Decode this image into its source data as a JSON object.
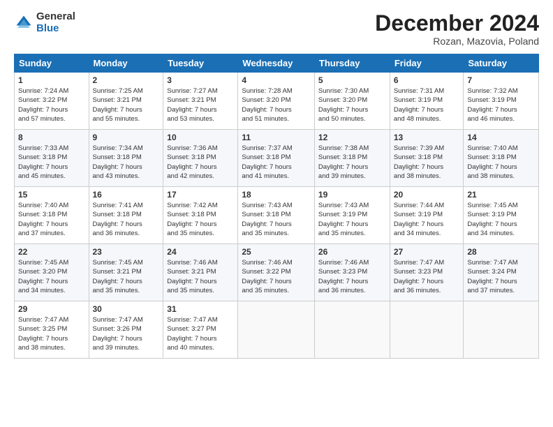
{
  "logo": {
    "general": "General",
    "blue": "Blue"
  },
  "header": {
    "month": "December 2024",
    "location": "Rozan, Mazovia, Poland"
  },
  "weekdays": [
    "Sunday",
    "Monday",
    "Tuesday",
    "Wednesday",
    "Thursday",
    "Friday",
    "Saturday"
  ],
  "weeks": [
    [
      {
        "day": "1",
        "info": "Sunrise: 7:24 AM\nSunset: 3:22 PM\nDaylight: 7 hours\nand 57 minutes."
      },
      {
        "day": "2",
        "info": "Sunrise: 7:25 AM\nSunset: 3:21 PM\nDaylight: 7 hours\nand 55 minutes."
      },
      {
        "day": "3",
        "info": "Sunrise: 7:27 AM\nSunset: 3:21 PM\nDaylight: 7 hours\nand 53 minutes."
      },
      {
        "day": "4",
        "info": "Sunrise: 7:28 AM\nSunset: 3:20 PM\nDaylight: 7 hours\nand 51 minutes."
      },
      {
        "day": "5",
        "info": "Sunrise: 7:30 AM\nSunset: 3:20 PM\nDaylight: 7 hours\nand 50 minutes."
      },
      {
        "day": "6",
        "info": "Sunrise: 7:31 AM\nSunset: 3:19 PM\nDaylight: 7 hours\nand 48 minutes."
      },
      {
        "day": "7",
        "info": "Sunrise: 7:32 AM\nSunset: 3:19 PM\nDaylight: 7 hours\nand 46 minutes."
      }
    ],
    [
      {
        "day": "8",
        "info": "Sunrise: 7:33 AM\nSunset: 3:18 PM\nDaylight: 7 hours\nand 45 minutes."
      },
      {
        "day": "9",
        "info": "Sunrise: 7:34 AM\nSunset: 3:18 PM\nDaylight: 7 hours\nand 43 minutes."
      },
      {
        "day": "10",
        "info": "Sunrise: 7:36 AM\nSunset: 3:18 PM\nDaylight: 7 hours\nand 42 minutes."
      },
      {
        "day": "11",
        "info": "Sunrise: 7:37 AM\nSunset: 3:18 PM\nDaylight: 7 hours\nand 41 minutes."
      },
      {
        "day": "12",
        "info": "Sunrise: 7:38 AM\nSunset: 3:18 PM\nDaylight: 7 hours\nand 39 minutes."
      },
      {
        "day": "13",
        "info": "Sunrise: 7:39 AM\nSunset: 3:18 PM\nDaylight: 7 hours\nand 38 minutes."
      },
      {
        "day": "14",
        "info": "Sunrise: 7:40 AM\nSunset: 3:18 PM\nDaylight: 7 hours\nand 38 minutes."
      }
    ],
    [
      {
        "day": "15",
        "info": "Sunrise: 7:40 AM\nSunset: 3:18 PM\nDaylight: 7 hours\nand 37 minutes."
      },
      {
        "day": "16",
        "info": "Sunrise: 7:41 AM\nSunset: 3:18 PM\nDaylight: 7 hours\nand 36 minutes."
      },
      {
        "day": "17",
        "info": "Sunrise: 7:42 AM\nSunset: 3:18 PM\nDaylight: 7 hours\nand 35 minutes."
      },
      {
        "day": "18",
        "info": "Sunrise: 7:43 AM\nSunset: 3:18 PM\nDaylight: 7 hours\nand 35 minutes."
      },
      {
        "day": "19",
        "info": "Sunrise: 7:43 AM\nSunset: 3:19 PM\nDaylight: 7 hours\nand 35 minutes."
      },
      {
        "day": "20",
        "info": "Sunrise: 7:44 AM\nSunset: 3:19 PM\nDaylight: 7 hours\nand 34 minutes."
      },
      {
        "day": "21",
        "info": "Sunrise: 7:45 AM\nSunset: 3:19 PM\nDaylight: 7 hours\nand 34 minutes."
      }
    ],
    [
      {
        "day": "22",
        "info": "Sunrise: 7:45 AM\nSunset: 3:20 PM\nDaylight: 7 hours\nand 34 minutes."
      },
      {
        "day": "23",
        "info": "Sunrise: 7:45 AM\nSunset: 3:21 PM\nDaylight: 7 hours\nand 35 minutes."
      },
      {
        "day": "24",
        "info": "Sunrise: 7:46 AM\nSunset: 3:21 PM\nDaylight: 7 hours\nand 35 minutes."
      },
      {
        "day": "25",
        "info": "Sunrise: 7:46 AM\nSunset: 3:22 PM\nDaylight: 7 hours\nand 35 minutes."
      },
      {
        "day": "26",
        "info": "Sunrise: 7:46 AM\nSunset: 3:23 PM\nDaylight: 7 hours\nand 36 minutes."
      },
      {
        "day": "27",
        "info": "Sunrise: 7:47 AM\nSunset: 3:23 PM\nDaylight: 7 hours\nand 36 minutes."
      },
      {
        "day": "28",
        "info": "Sunrise: 7:47 AM\nSunset: 3:24 PM\nDaylight: 7 hours\nand 37 minutes."
      }
    ],
    [
      {
        "day": "29",
        "info": "Sunrise: 7:47 AM\nSunset: 3:25 PM\nDaylight: 7 hours\nand 38 minutes."
      },
      {
        "day": "30",
        "info": "Sunrise: 7:47 AM\nSunset: 3:26 PM\nDaylight: 7 hours\nand 39 minutes."
      },
      {
        "day": "31",
        "info": "Sunrise: 7:47 AM\nSunset: 3:27 PM\nDaylight: 7 hours\nand 40 minutes."
      },
      {
        "day": "",
        "info": ""
      },
      {
        "day": "",
        "info": ""
      },
      {
        "day": "",
        "info": ""
      },
      {
        "day": "",
        "info": ""
      }
    ]
  ]
}
